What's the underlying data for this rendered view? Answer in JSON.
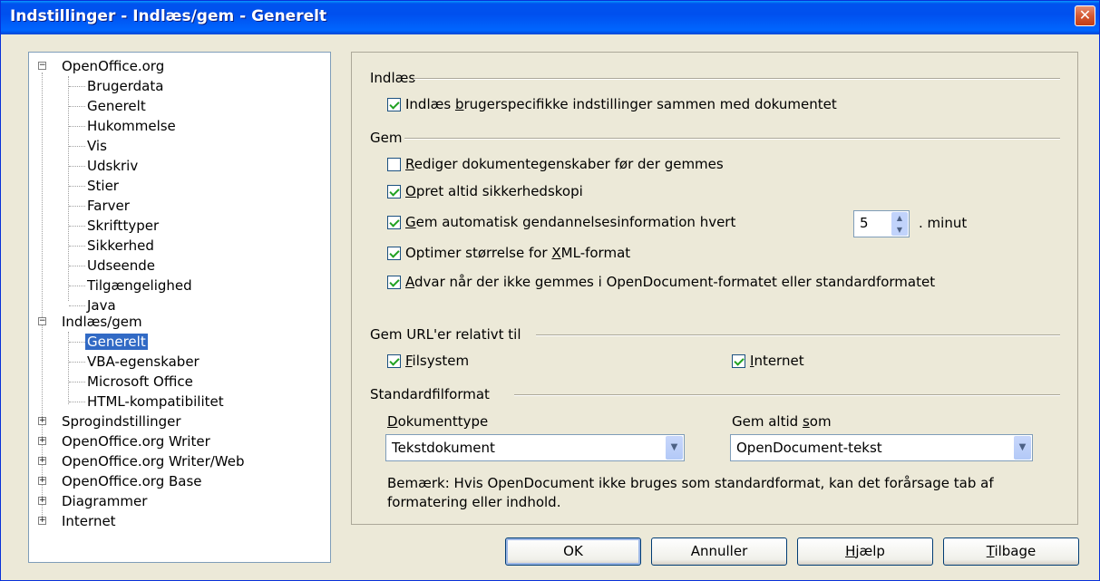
{
  "window": {
    "title": "Indstillinger - Indlæs/gem - Generelt",
    "close_glyph": "✕"
  },
  "tree": {
    "openoffice": {
      "label": "OpenOffice.org",
      "expander": "−",
      "children": [
        "Brugerdata",
        "Generelt",
        "Hukommelse",
        "Vis",
        "Udskriv",
        "Stier",
        "Farver",
        "Skrifttyper",
        "Sikkerhed",
        "Udseende",
        "Tilgængelighed",
        "Java"
      ]
    },
    "indlaes": {
      "label": "Indlæs/gem",
      "expander": "−",
      "children": [
        "Generelt",
        "VBA-egenskaber",
        "Microsoft Office",
        "HTML-kompatibilitet"
      ]
    },
    "collapsed": [
      {
        "label": "Sprogindstillinger",
        "expander": "+"
      },
      {
        "label": "OpenOffice.org Writer",
        "expander": "+"
      },
      {
        "label": "OpenOffice.org Writer/Web",
        "expander": "+"
      },
      {
        "label": "OpenOffice.org Base",
        "expander": "+"
      },
      {
        "label": "Diagrammer",
        "expander": "+"
      },
      {
        "label": "Internet",
        "expander": "+"
      }
    ]
  },
  "indlaes_section": {
    "label": "Indlæs",
    "load_user_settings": {
      "pre": "Indlæs ",
      "u": "b",
      "post": "rugerspecifikke indstillinger sammen med dokumentet",
      "checked": true
    }
  },
  "gem_section": {
    "label": "Gem",
    "edit_props": {
      "u": "R",
      "post": "ediger dokumentegenskaber før der gemmes",
      "checked": false
    },
    "backup": {
      "u": "O",
      "post": "pret altid sikkerhedskopi",
      "checked": true
    },
    "autosave": {
      "u": "G",
      "post": "em automatisk gendannelsesinformation hvert",
      "checked": true,
      "minutes": "5",
      "unit": ". minut"
    },
    "xml_size": {
      "pre": "Optimer størrelse for ",
      "u": "X",
      "post": "ML-format",
      "checked": true
    },
    "warn_odf": {
      "u": "A",
      "post": "dvar når der ikke gemmes i OpenDocument-formatet eller standardformatet",
      "checked": true
    }
  },
  "url_section": {
    "label": "Gem URL'er relativt til",
    "filesystem": {
      "u": "F",
      "post": "ilsystem",
      "checked": true
    },
    "internet": {
      "u": "I",
      "post": "nternet",
      "checked": true
    }
  },
  "format_section": {
    "label": "Standardfilformat",
    "doctype_label": {
      "u": "D",
      "post": "okumenttype"
    },
    "doctype_value": "Tekstdokument",
    "saveas_label": {
      "pre": "Gem altid ",
      "u": "s",
      "post": "om"
    },
    "saveas_value": "OpenDocument-tekst",
    "note_line1": "Bemærk: Hvis OpenDocument ikke bruges som standardformat, kan det forårsage tab af",
    "note_line2": "formatering eller indhold."
  },
  "buttons": {
    "ok": "OK",
    "cancel": "Annuller",
    "help": {
      "u": "H",
      "post": "jælp"
    },
    "back": {
      "u": "T",
      "post": "ilbage"
    }
  }
}
